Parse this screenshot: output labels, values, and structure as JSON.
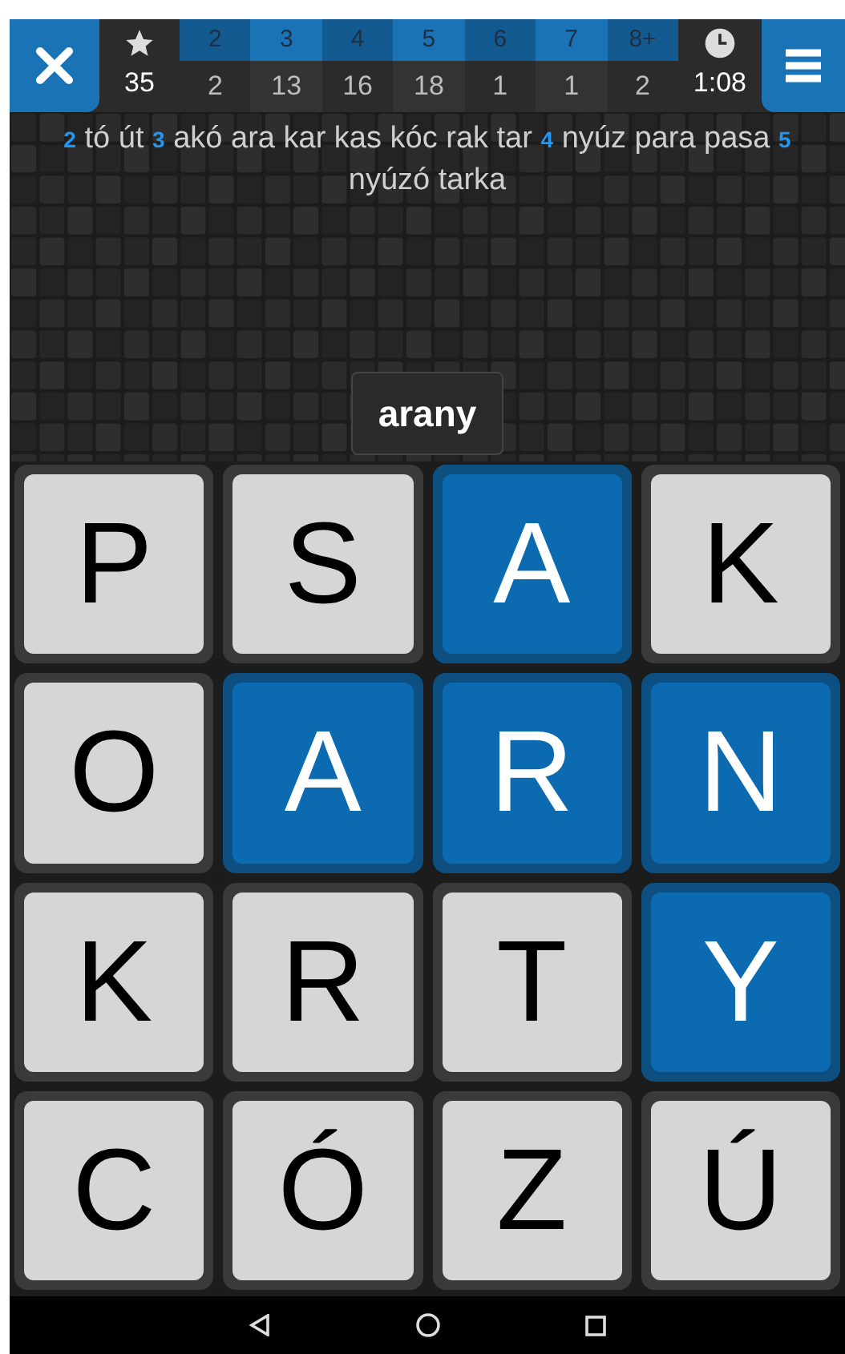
{
  "score": "35",
  "length_counts": [
    {
      "label": "2",
      "count": "2"
    },
    {
      "label": "3",
      "count": "13"
    },
    {
      "label": "4",
      "count": "16"
    },
    {
      "label": "5",
      "count": "18"
    },
    {
      "label": "6",
      "count": "1"
    },
    {
      "label": "7",
      "count": "1"
    },
    {
      "label": "8+",
      "count": "2"
    }
  ],
  "time": "1:08",
  "found_words": [
    {
      "length": "2",
      "words": "tó út"
    },
    {
      "length": "3",
      "words": "akó ara kar kas kóc rak tar"
    },
    {
      "length": "4",
      "words": "nyúz para pasa"
    },
    {
      "length": "5",
      "words": "nyúzó tarka"
    }
  ],
  "current_word": "arany",
  "tiles": [
    {
      "letter": "P",
      "selected": false
    },
    {
      "letter": "S",
      "selected": false
    },
    {
      "letter": "A",
      "selected": true
    },
    {
      "letter": "K",
      "selected": false
    },
    {
      "letter": "O",
      "selected": false
    },
    {
      "letter": "A",
      "selected": true
    },
    {
      "letter": "R",
      "selected": true
    },
    {
      "letter": "N",
      "selected": true
    },
    {
      "letter": "K",
      "selected": false
    },
    {
      "letter": "R",
      "selected": false
    },
    {
      "letter": "T",
      "selected": false
    },
    {
      "letter": "Y",
      "selected": true
    },
    {
      "letter": "C",
      "selected": false
    },
    {
      "letter": "Ó",
      "selected": false
    },
    {
      "letter": "Z",
      "selected": false
    },
    {
      "letter": "Ú",
      "selected": false
    }
  ]
}
